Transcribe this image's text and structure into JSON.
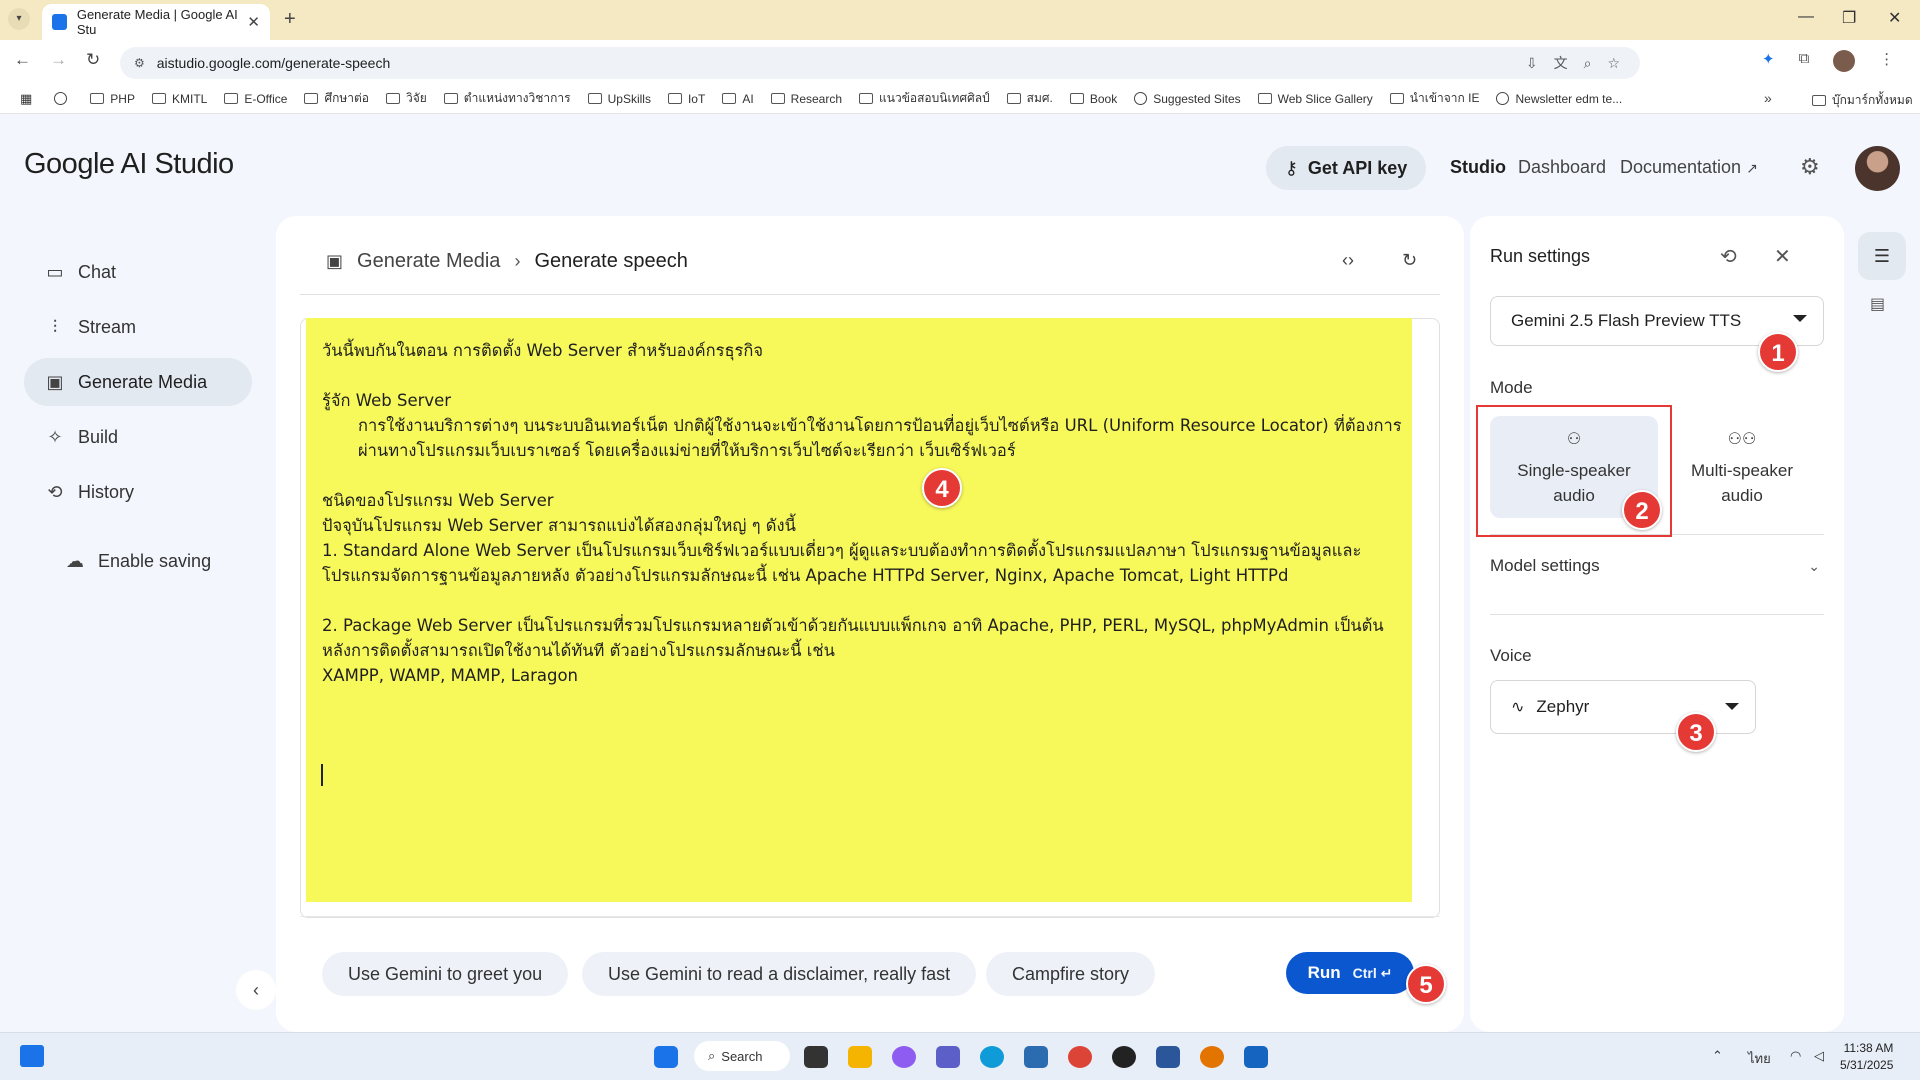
{
  "browser": {
    "tab_title": "Generate Media | Google AI Stu",
    "url": "aistudio.google.com/generate-speech",
    "bookmarks": [
      "PHP",
      "KMITL",
      "E-Office",
      "ศึกษาต่อ",
      "วิจัย",
      "ตำแหน่งทางวิชาการ",
      "UpSkills",
      "IoT",
      "AI",
      "Research",
      "แนวข้อสอบนิเทศศิลป์",
      "สมศ.",
      "Book",
      "Suggested Sites",
      "Web Slice Gallery",
      "นำเข้าจาก IE",
      "Newsletter edm te..."
    ],
    "all_bookmarks": "บุ๊กมาร์กทั้งหมด"
  },
  "header": {
    "logo_google": "Google",
    "logo_product": "AI Studio",
    "api_key_label": "Get API key",
    "nav_studio": "Studio",
    "nav_dashboard": "Dashboard",
    "nav_documentation": "Documentation"
  },
  "sidebar": {
    "items": [
      {
        "label": "Chat"
      },
      {
        "label": "Stream"
      },
      {
        "label": "Generate Media"
      },
      {
        "label": "Build"
      },
      {
        "label": "History"
      }
    ],
    "enable_saving": "Enable saving"
  },
  "main": {
    "breadcrumb_parent": "Generate Media",
    "breadcrumb_current": "Generate speech",
    "script_lines": [
      "วันนี้พบกันในตอน การติดตั้ง Web Server สำหรับองค์กรธุรกิจ",
      "",
      "รู้จัก Web Server",
      "การใช้งานบริการต่างๆ บนระบบอินเทอร์เน็ต ปกติผู้ใช้งานจะเข้าใช้งานโดยการป้อนที่อยู่เว็บไซต์หรือ URL (Uniform Resource Locator) ที่ต้องการผ่านทางโปรแกรมเว็บเบราเซอร์ โดยเครื่องแม่ข่ายที่ให้บริการเว็บไซต์จะเรียกว่า เว็บเซิร์ฟเวอร์",
      "",
      "ชนิดของโปรแกรม Web Server",
      "ปัจจุบันโปรแกรม Web Server สามารถแบ่งได้สองกลุ่มใหญ่ ๆ ดังนี้",
      "1. Standard Alone Web Server เป็นโปรแกรมเว็บเซิร์ฟเวอร์แบบเดี่ยวๆ ผู้ดูแลระบบต้องทำการติดตั้งโปรแกรมแปลภาษา โปรแกรมฐานข้อมูลและโปรแกรมจัดการฐานข้อมูลภายหลัง ตัวอย่างโปรแกรมลักษณะนี้ เช่น Apache HTTPd Server, Nginx, Apache Tomcat, Light HTTPd",
      "",
      "2. Package Web Server เป็นโปรแกรมที่รวมโปรแกรมหลายตัวเข้าด้วยกันแบบแพ็กเกจ อาทิ Apache, PHP, PERL, MySQL, phpMyAdmin เป็นต้น หลังการติดตั้งสามารถเปิดใช้งานได้ทันที ตัวอย่างโปรแกรมลักษณะนี้ เช่น",
      "XAMPP, WAMP, MAMP, Laragon"
    ],
    "chips": [
      "Use Gemini to greet you",
      "Use Gemini to read a disclaimer, really fast",
      "Campfire story"
    ],
    "run_label": "Run",
    "run_shortcut": "Ctrl"
  },
  "run_settings": {
    "title": "Run settings",
    "model": "Gemini 2.5 Flash Preview TTS",
    "mode_label": "Mode",
    "mode_single_line1": "Single-speaker",
    "mode_single_line2": "audio",
    "mode_multi_line1": "Multi-speaker",
    "mode_multi_line2": "audio",
    "model_settings": "Model settings",
    "voice_label": "Voice",
    "voice": "Zephyr"
  },
  "annotations": [
    "1",
    "2",
    "3",
    "4",
    "5"
  ],
  "taskbar": {
    "search": "Search",
    "lang": "ไทย",
    "time": "11:38 AM",
    "date": "5/31/2025"
  }
}
